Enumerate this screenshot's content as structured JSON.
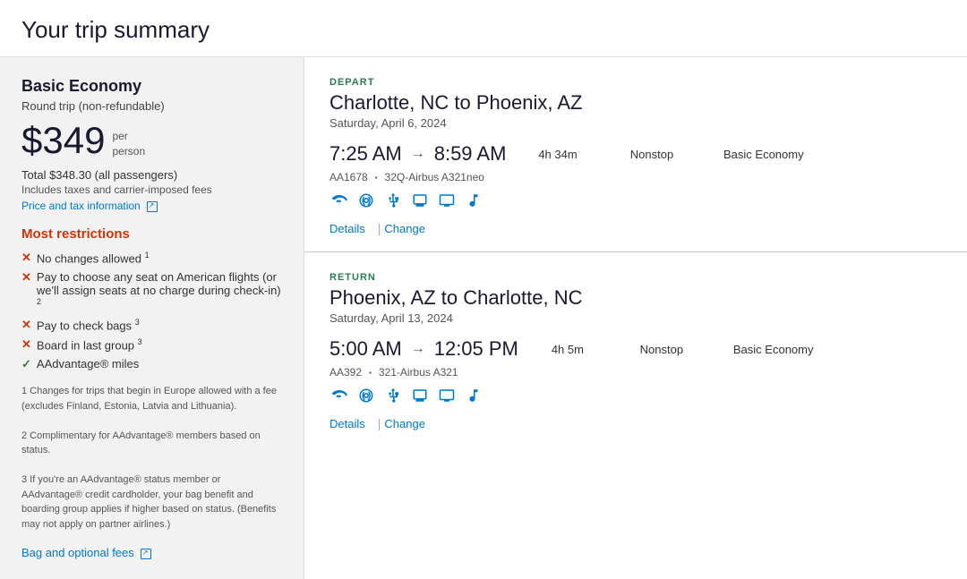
{
  "page": {
    "title": "Your trip summary"
  },
  "left_panel": {
    "fare_class": "Basic Economy",
    "trip_type": "Round trip (non-refundable)",
    "price": "$349",
    "per_person": "per\nperson",
    "total_price": "Total $348.30 (all passengers)",
    "includes_taxes": "Includes taxes and carrier-imposed fees",
    "price_tax_link": "Price and tax information",
    "most_restrictions_label": "Most restrictions",
    "restrictions": [
      {
        "type": "x",
        "text": "No changes allowed",
        "sup": "1"
      },
      {
        "type": "x",
        "text": "Pay to choose any seat on American flights (or we'll assign seats at no charge during check-in)",
        "sup": "2"
      },
      {
        "type": "x",
        "text": "Pay to check bags",
        "sup": "3"
      },
      {
        "type": "x",
        "text": "Board in last group",
        "sup": "3"
      },
      {
        "type": "check",
        "text": "AAdvantage® miles",
        "sup": ""
      }
    ],
    "footnote1": "1 Changes for trips that begin in Europe allowed with a fee (excludes Finland, Estonia, Latvia and Lithuania).",
    "footnote2": "2 Complimentary for AAdvantage® members based on status.",
    "footnote3": "3 If you're an AAdvantage® status member or AAdvantage® credit cardholder, your bag benefit and boarding group applies if higher based on status. (Benefits may not apply on partner airlines.)",
    "bag_fees_link": "Bag and optional fees"
  },
  "depart": {
    "section_label": "DEPART",
    "route": "Charlotte, NC to Phoenix, AZ",
    "date": "Saturday, April 6, 2024",
    "depart_time": "7:25 AM",
    "arrive_time": "8:59 AM",
    "duration": "4h 34m",
    "nonstop": "Nonstop",
    "cabin": "Basic Economy",
    "flight_num": "AA1678",
    "aircraft": "32Q-Airbus A321neo",
    "details_link": "Details",
    "change_link": "Change"
  },
  "return": {
    "section_label": "RETURN",
    "route": "Phoenix, AZ to Charlotte, NC",
    "date": "Saturday, April 13, 2024",
    "depart_time": "5:00 AM",
    "arrive_time": "12:05 PM",
    "duration": "4h 5m",
    "nonstop": "Nonstop",
    "cabin": "Basic Economy",
    "flight_num": "AA392",
    "aircraft": "321-Airbus A321",
    "details_link": "Details",
    "change_link": "Change"
  },
  "icons": {
    "wifi": "wifi",
    "power": "power",
    "usb": "usb",
    "screen": "screen",
    "tv": "tv",
    "music": "music"
  }
}
